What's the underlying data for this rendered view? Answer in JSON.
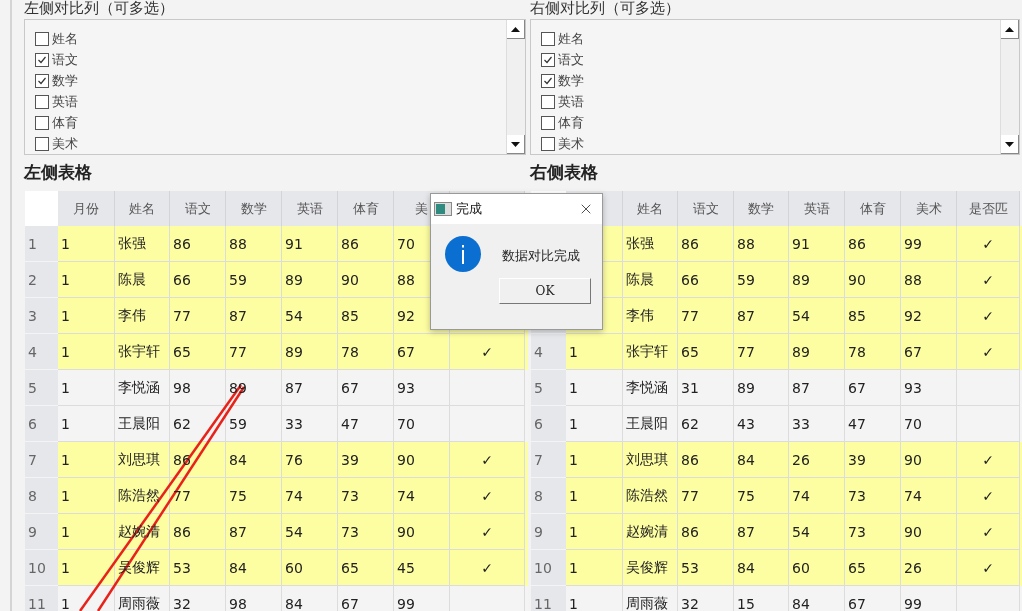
{
  "panels": [
    {
      "title": "左侧对比列（可多选）",
      "options": [
        {
          "label": "姓名",
          "checked": false
        },
        {
          "label": "语文",
          "checked": true
        },
        {
          "label": "数学",
          "checked": true
        },
        {
          "label": "英语",
          "checked": false
        },
        {
          "label": "体育",
          "checked": false
        },
        {
          "label": "美术",
          "checked": false
        }
      ],
      "table_title": "左侧表格",
      "table": {
        "columns": [
          {
            "label": "月份"
          },
          {
            "label": "姓名"
          },
          {
            "label": "语文"
          },
          {
            "label": "数学"
          },
          {
            "label": "英语"
          },
          {
            "label": "体育"
          },
          {
            "label": "美"
          },
          {}
        ],
        "rows": [
          {
            "num": "1",
            "highlighted": true,
            "cells": [
              "1",
              "张强",
              "86",
              "88",
              "91",
              "86",
              "70",
              null
            ]
          },
          {
            "num": "2",
            "highlighted": true,
            "cells": [
              "1",
              "陈晨",
              "66",
              "59",
              "89",
              "90",
              "88",
              null
            ]
          },
          {
            "num": "3",
            "highlighted": true,
            "cells": [
              "1",
              "李伟",
              "77",
              "87",
              "54",
              "85",
              "92",
              null
            ]
          },
          {
            "num": "4",
            "highlighted": true,
            "cells": [
              "1",
              "张宇轩",
              "65",
              "77",
              "89",
              "78",
              "67",
              "✓"
            ]
          },
          {
            "num": "5",
            "highlighted": false,
            "cells": [
              "1",
              "李悦涵",
              "98",
              "89",
              "87",
              "67",
              "93",
              null
            ]
          },
          {
            "num": "6",
            "highlighted": false,
            "cells": [
              "1",
              "王晨阳",
              "62",
              "59",
              "33",
              "47",
              "70",
              null
            ]
          },
          {
            "num": "7",
            "highlighted": true,
            "cells": [
              "1",
              "刘思琪",
              "86",
              "84",
              "76",
              "39",
              "90",
              "✓"
            ]
          },
          {
            "num": "8",
            "highlighted": true,
            "cells": [
              "1",
              "陈浩然",
              "77",
              "75",
              "74",
              "73",
              "74",
              "✓"
            ]
          },
          {
            "num": "9",
            "highlighted": true,
            "cells": [
              "1",
              "赵婉清",
              "86",
              "87",
              "54",
              "73",
              "90",
              "✓"
            ]
          },
          {
            "num": "10",
            "highlighted": true,
            "cells": [
              "1",
              "吴俊辉",
              "53",
              "84",
              "60",
              "65",
              "45",
              "✓"
            ]
          },
          {
            "num": "11",
            "highlighted": false,
            "cells": [
              "1",
              "周雨薇",
              "32",
              "98",
              "84",
              "67",
              "99",
              null
            ]
          }
        ]
      }
    },
    {
      "title": "右侧对比列（可多选）",
      "options": [
        {
          "label": "姓名",
          "checked": false
        },
        {
          "label": "语文",
          "checked": true
        },
        {
          "label": "数学",
          "checked": true
        },
        {
          "label": "英语",
          "checked": false
        },
        {
          "label": "体育",
          "checked": false
        },
        {
          "label": "美术",
          "checked": false
        }
      ],
      "table_title": "右侧表格",
      "table": {
        "columns": [
          {},
          {
            "label": "姓名"
          },
          {
            "label": "语文"
          },
          {
            "label": "数学"
          },
          {
            "label": "英语"
          },
          {
            "label": "体育"
          },
          {
            "label": "美术"
          },
          {
            "label": "是否匹"
          }
        ],
        "rows": [
          {
            "num": null,
            "highlighted": true,
            "cells": [
              null,
              "张强",
              "86",
              "88",
              "91",
              "86",
              "99",
              "✓"
            ]
          },
          {
            "num": null,
            "highlighted": true,
            "cells": [
              null,
              "陈晨",
              "66",
              "59",
              "89",
              "90",
              "88",
              "✓"
            ]
          },
          {
            "num": null,
            "highlighted": true,
            "cells": [
              null,
              "李伟",
              "77",
              "87",
              "54",
              "85",
              "92",
              "✓"
            ]
          },
          {
            "num": "4",
            "highlighted": true,
            "cells": [
              "1",
              "张宇轩",
              "65",
              "77",
              "89",
              "78",
              "67",
              "✓"
            ]
          },
          {
            "num": "5",
            "highlighted": false,
            "cells": [
              "1",
              "李悦涵",
              "31",
              "89",
              "87",
              "67",
              "93",
              null
            ]
          },
          {
            "num": "6",
            "highlighted": false,
            "cells": [
              "1",
              "王晨阳",
              "62",
              "43",
              "33",
              "47",
              "70",
              null
            ]
          },
          {
            "num": "7",
            "highlighted": true,
            "cells": [
              "1",
              "刘思琪",
              "86",
              "84",
              "26",
              "39",
              "90",
              "✓"
            ]
          },
          {
            "num": "8",
            "highlighted": true,
            "cells": [
              "1",
              "陈浩然",
              "77",
              "75",
              "74",
              "73",
              "74",
              "✓"
            ]
          },
          {
            "num": "9",
            "highlighted": true,
            "cells": [
              "1",
              "赵婉清",
              "86",
              "87",
              "54",
              "73",
              "90",
              "✓"
            ]
          },
          {
            "num": "10",
            "highlighted": true,
            "cells": [
              "1",
              "吴俊辉",
              "53",
              "84",
              "60",
              "65",
              "26",
              "✓"
            ]
          },
          {
            "num": "11",
            "highlighted": false,
            "cells": [
              "1",
              "周雨薇",
              "32",
              "15",
              "84",
              "67",
              "99",
              null
            ]
          }
        ]
      }
    }
  ],
  "dialog": {
    "title": "完成",
    "message": "数据对比完成",
    "button": "OK"
  }
}
